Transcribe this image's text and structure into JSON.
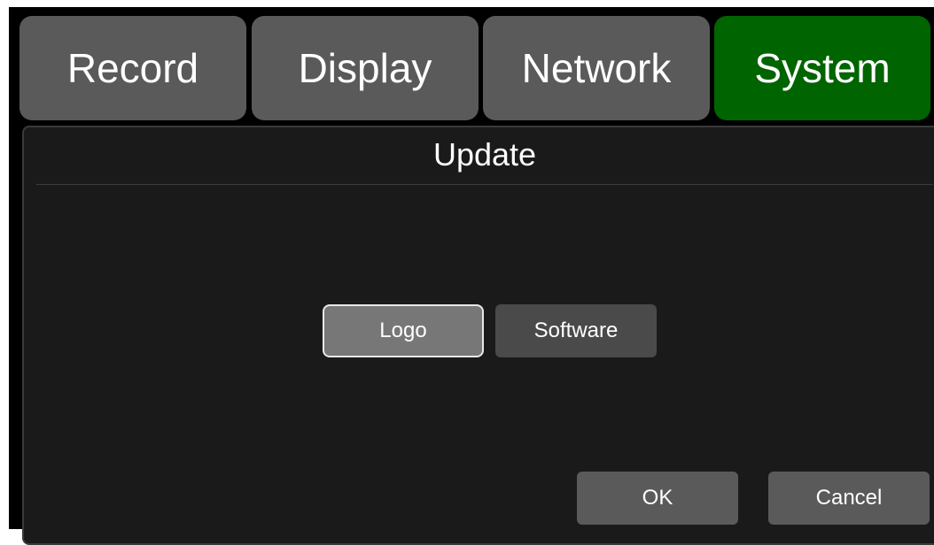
{
  "tabs": [
    {
      "label": "Record",
      "active": false
    },
    {
      "label": "Display",
      "active": false
    },
    {
      "label": "Network",
      "active": false
    },
    {
      "label": "System",
      "active": true
    }
  ],
  "dialog": {
    "title": "Update",
    "options": [
      {
        "label": "Logo",
        "selected": true
      },
      {
        "label": "Software",
        "selected": false
      }
    ],
    "ok_label": "OK",
    "cancel_label": "Cancel"
  },
  "colors": {
    "active_tab": "#006400",
    "inactive_tab": "#5a5a5a",
    "panel_background": "#1a1a1a",
    "selected_option_border": "#e8e8e8"
  }
}
